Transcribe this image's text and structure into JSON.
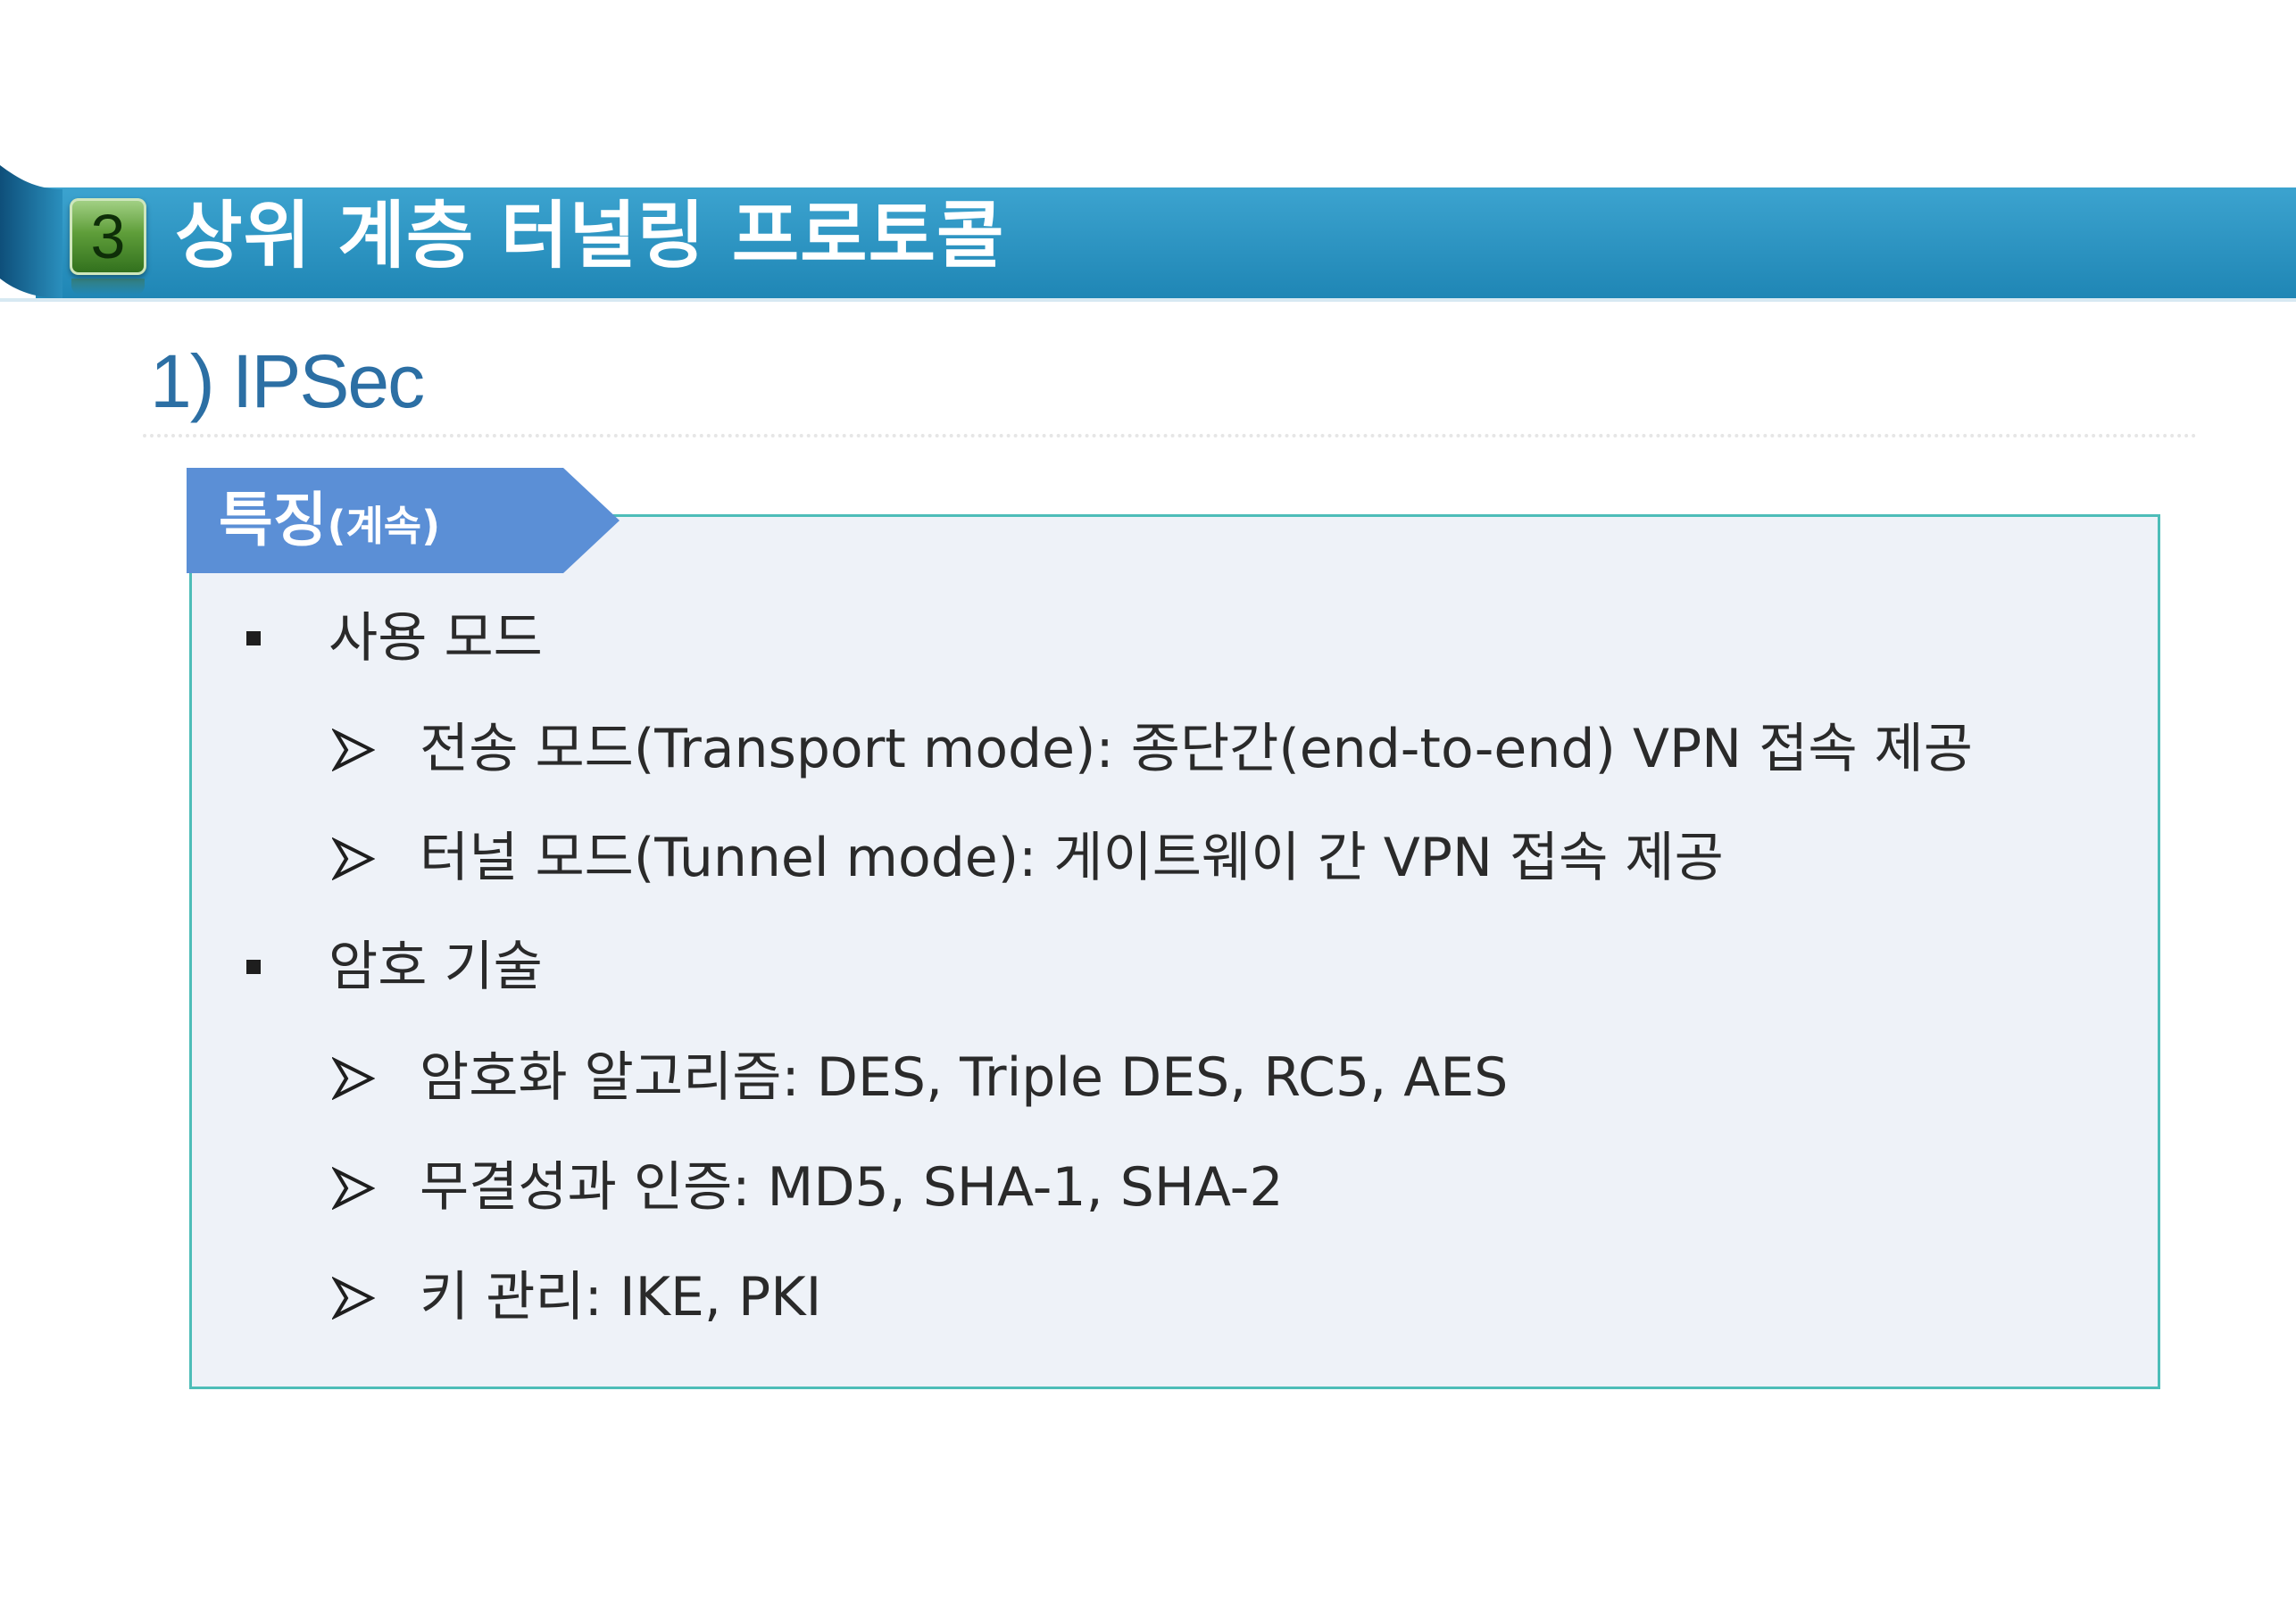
{
  "slide": {
    "banner": {
      "number": "3",
      "title": "상위 계층 터널링 프로토콜"
    },
    "section_heading": "1) IPSec",
    "tab": {
      "label": "특징",
      "suffix": "(계속)"
    },
    "bullets": [
      {
        "text": "사용 모드",
        "subitems": [
          "전송 모드(Transport mode): 종단간(end-to-end) VPN 접속 제공",
          "터널 모드(Tunnel mode): 게이트웨이 간 VPN 접속 제공"
        ]
      },
      {
        "text": "암호 기술",
        "subitems": [
          "암호화 알고리즘: DES, Triple DES, RC5, AES",
          "무결성과 인증: MD5, SHA-1, SHA-2",
          "키 관리: IKE, PKI"
        ]
      }
    ],
    "icons": {
      "bullet_level1": "square-bullet-icon",
      "bullet_level2": "arrowhead-bullet-icon"
    },
    "colors": {
      "banner": "#2a8fbd",
      "heading": "#2c6fa4",
      "tab": "#5b8fd6",
      "box_border": "#4dbdb8",
      "box_fill": "#eef2f8",
      "badge": "#5f9e3a"
    }
  }
}
